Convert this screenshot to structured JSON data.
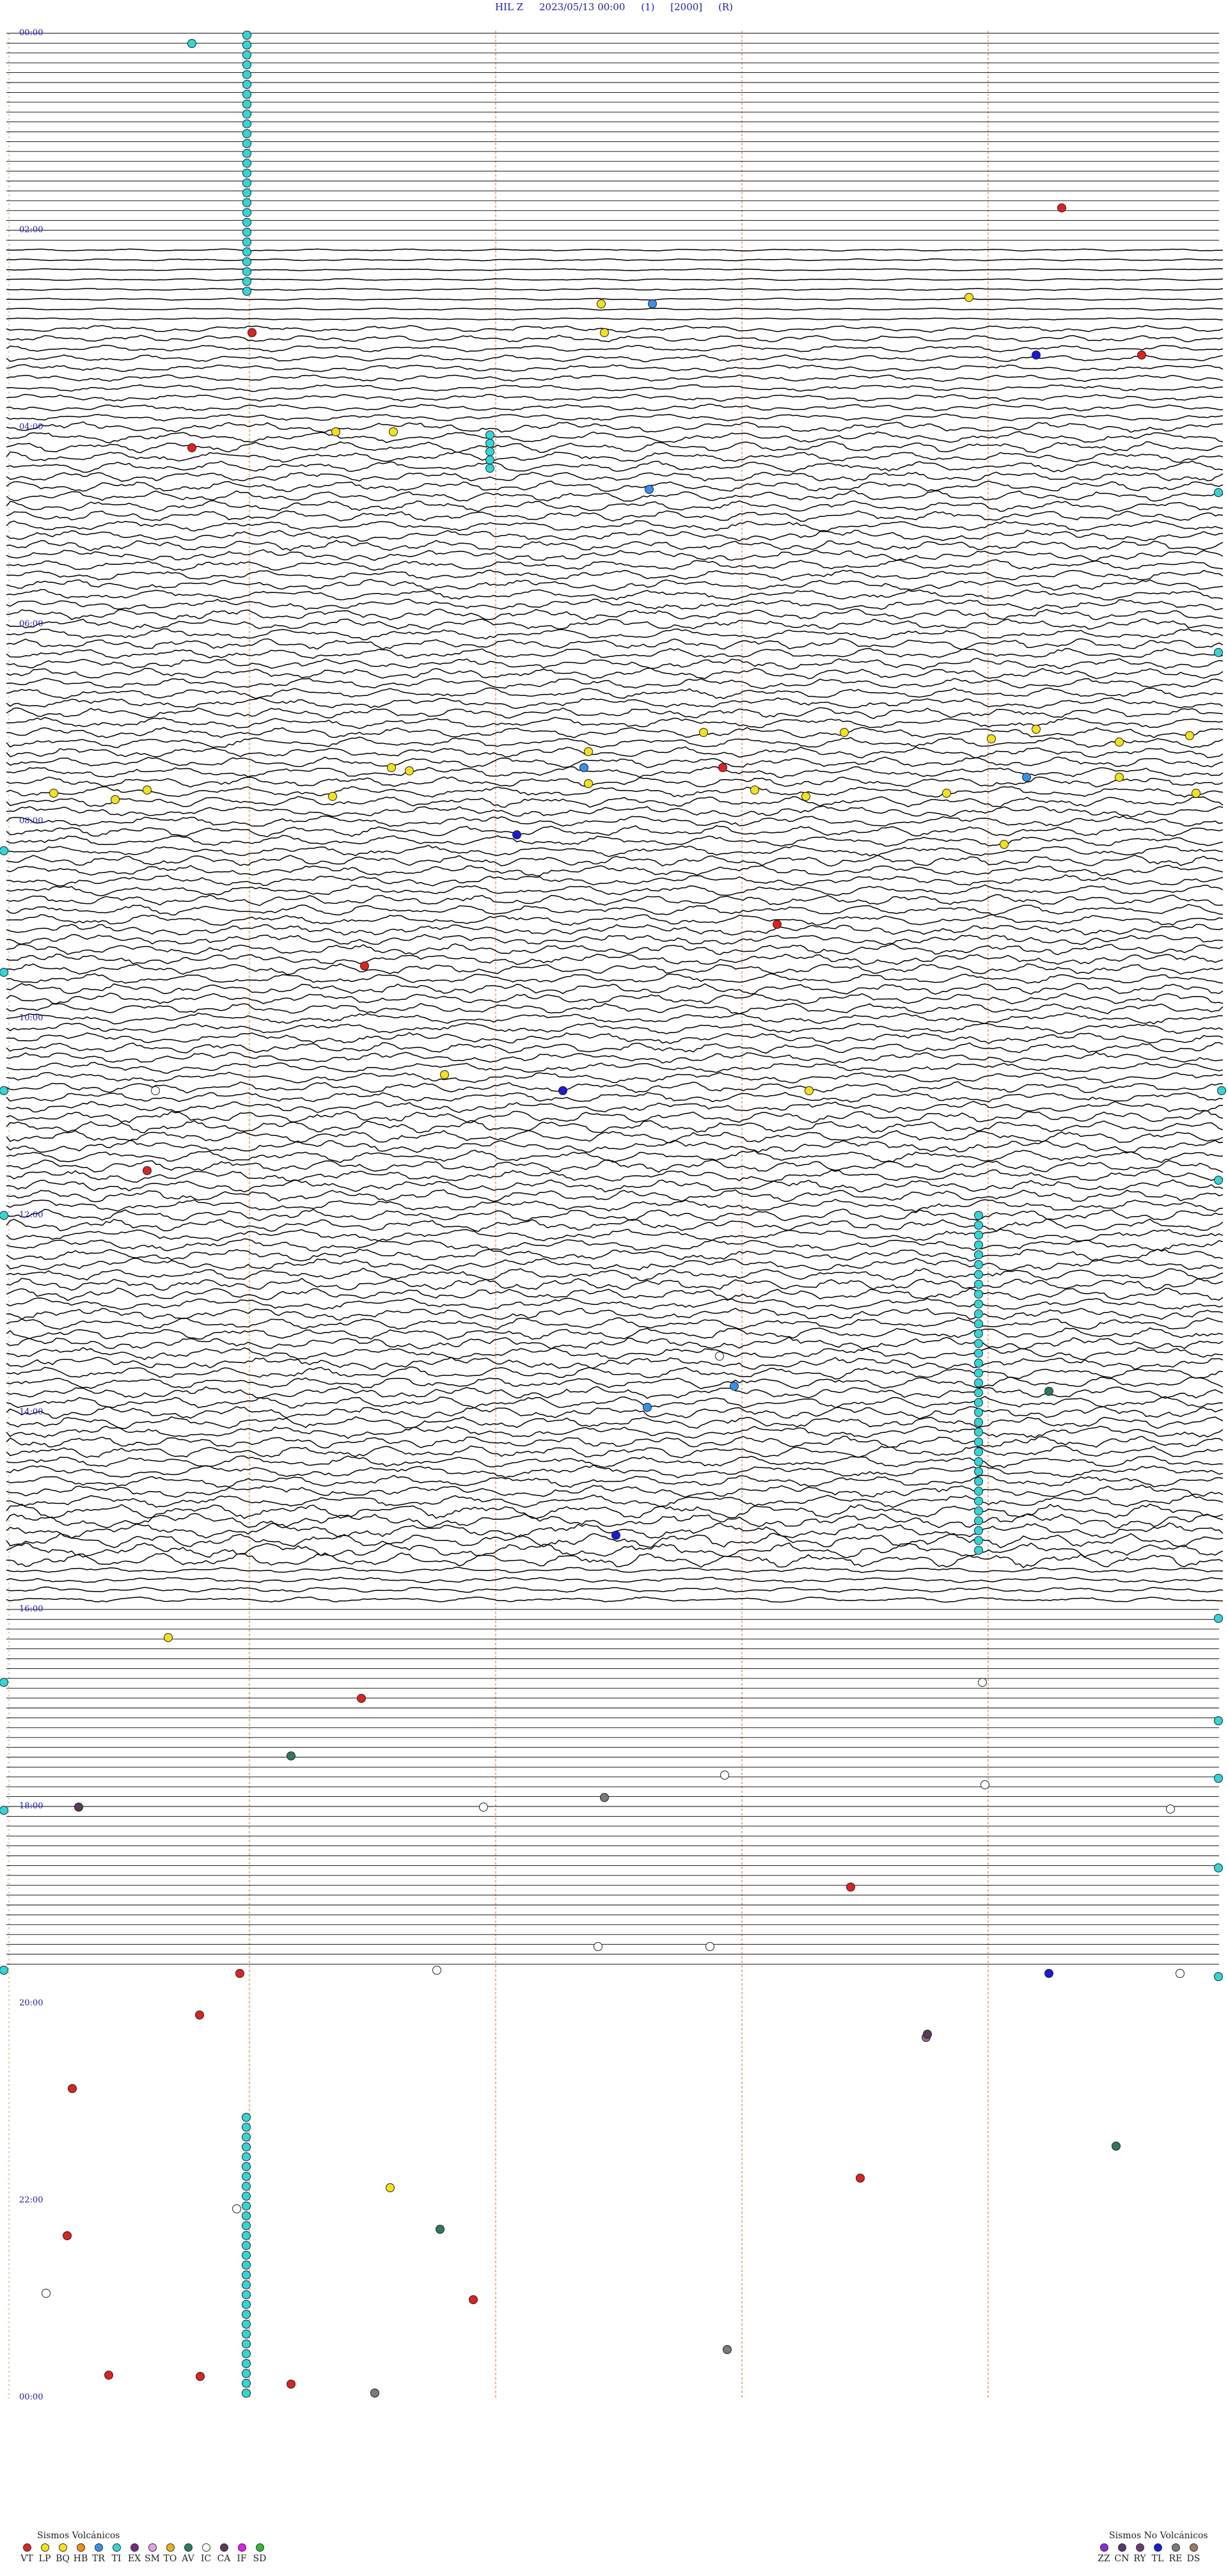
{
  "header": {
    "station": "HIL Z",
    "datetime": "2023/05/13 00:00",
    "field1": "(1)",
    "field2": "[2000]",
    "field3": "(R)"
  },
  "time_labels": [
    "00:00",
    "02:00",
    "04:00",
    "06:00",
    "08:00",
    "10:00",
    "12:00",
    "14:00",
    "16:00",
    "18:00",
    "20:00",
    "22:00",
    "00:00"
  ],
  "legend_volcanic": {
    "title": "Sismos Volcánicos",
    "items": [
      {
        "code": "VT",
        "color": "#dd2222"
      },
      {
        "code": "LP",
        "color": "#f2e21b"
      },
      {
        "code": "BQ",
        "color": "#f2e21b"
      },
      {
        "code": "HB",
        "color": "#f28c1b"
      },
      {
        "code": "TR",
        "color": "#3a8fe6"
      },
      {
        "code": "TI",
        "color": "#33d6d6"
      },
      {
        "code": "EX",
        "color": "#7a2b7a"
      },
      {
        "code": "SM",
        "color": "#e6a0e6"
      },
      {
        "code": "TO",
        "color": "#e6b31b"
      },
      {
        "code": "AV",
        "color": "#2e7a5a"
      },
      {
        "code": "IC",
        "color": "#ffffff"
      },
      {
        "code": "CA",
        "color": "#5a3a5a"
      },
      {
        "code": "IF",
        "color": "#e61be6"
      },
      {
        "code": "SD",
        "color": "#33b833"
      }
    ]
  },
  "legend_nonvolcanic": {
    "title": "Sismos No Volcánicos",
    "items": [
      {
        "code": "ZZ",
        "color": "#8a2be2"
      },
      {
        "code": "CN",
        "color": "#5a3a6a"
      },
      {
        "code": "RY",
        "color": "#6a3a7a"
      },
      {
        "code": "TL",
        "color": "#1b1bd6"
      },
      {
        "code": "RE",
        "color": "#7a7a7a"
      },
      {
        "code": "DS",
        "color": "#a07a5a"
      }
    ]
  },
  "colors": {
    "trace": "#000000",
    "guide_line": "#e8935a",
    "time_label": "#1a1acc",
    "header": "#1a1acc"
  }
}
